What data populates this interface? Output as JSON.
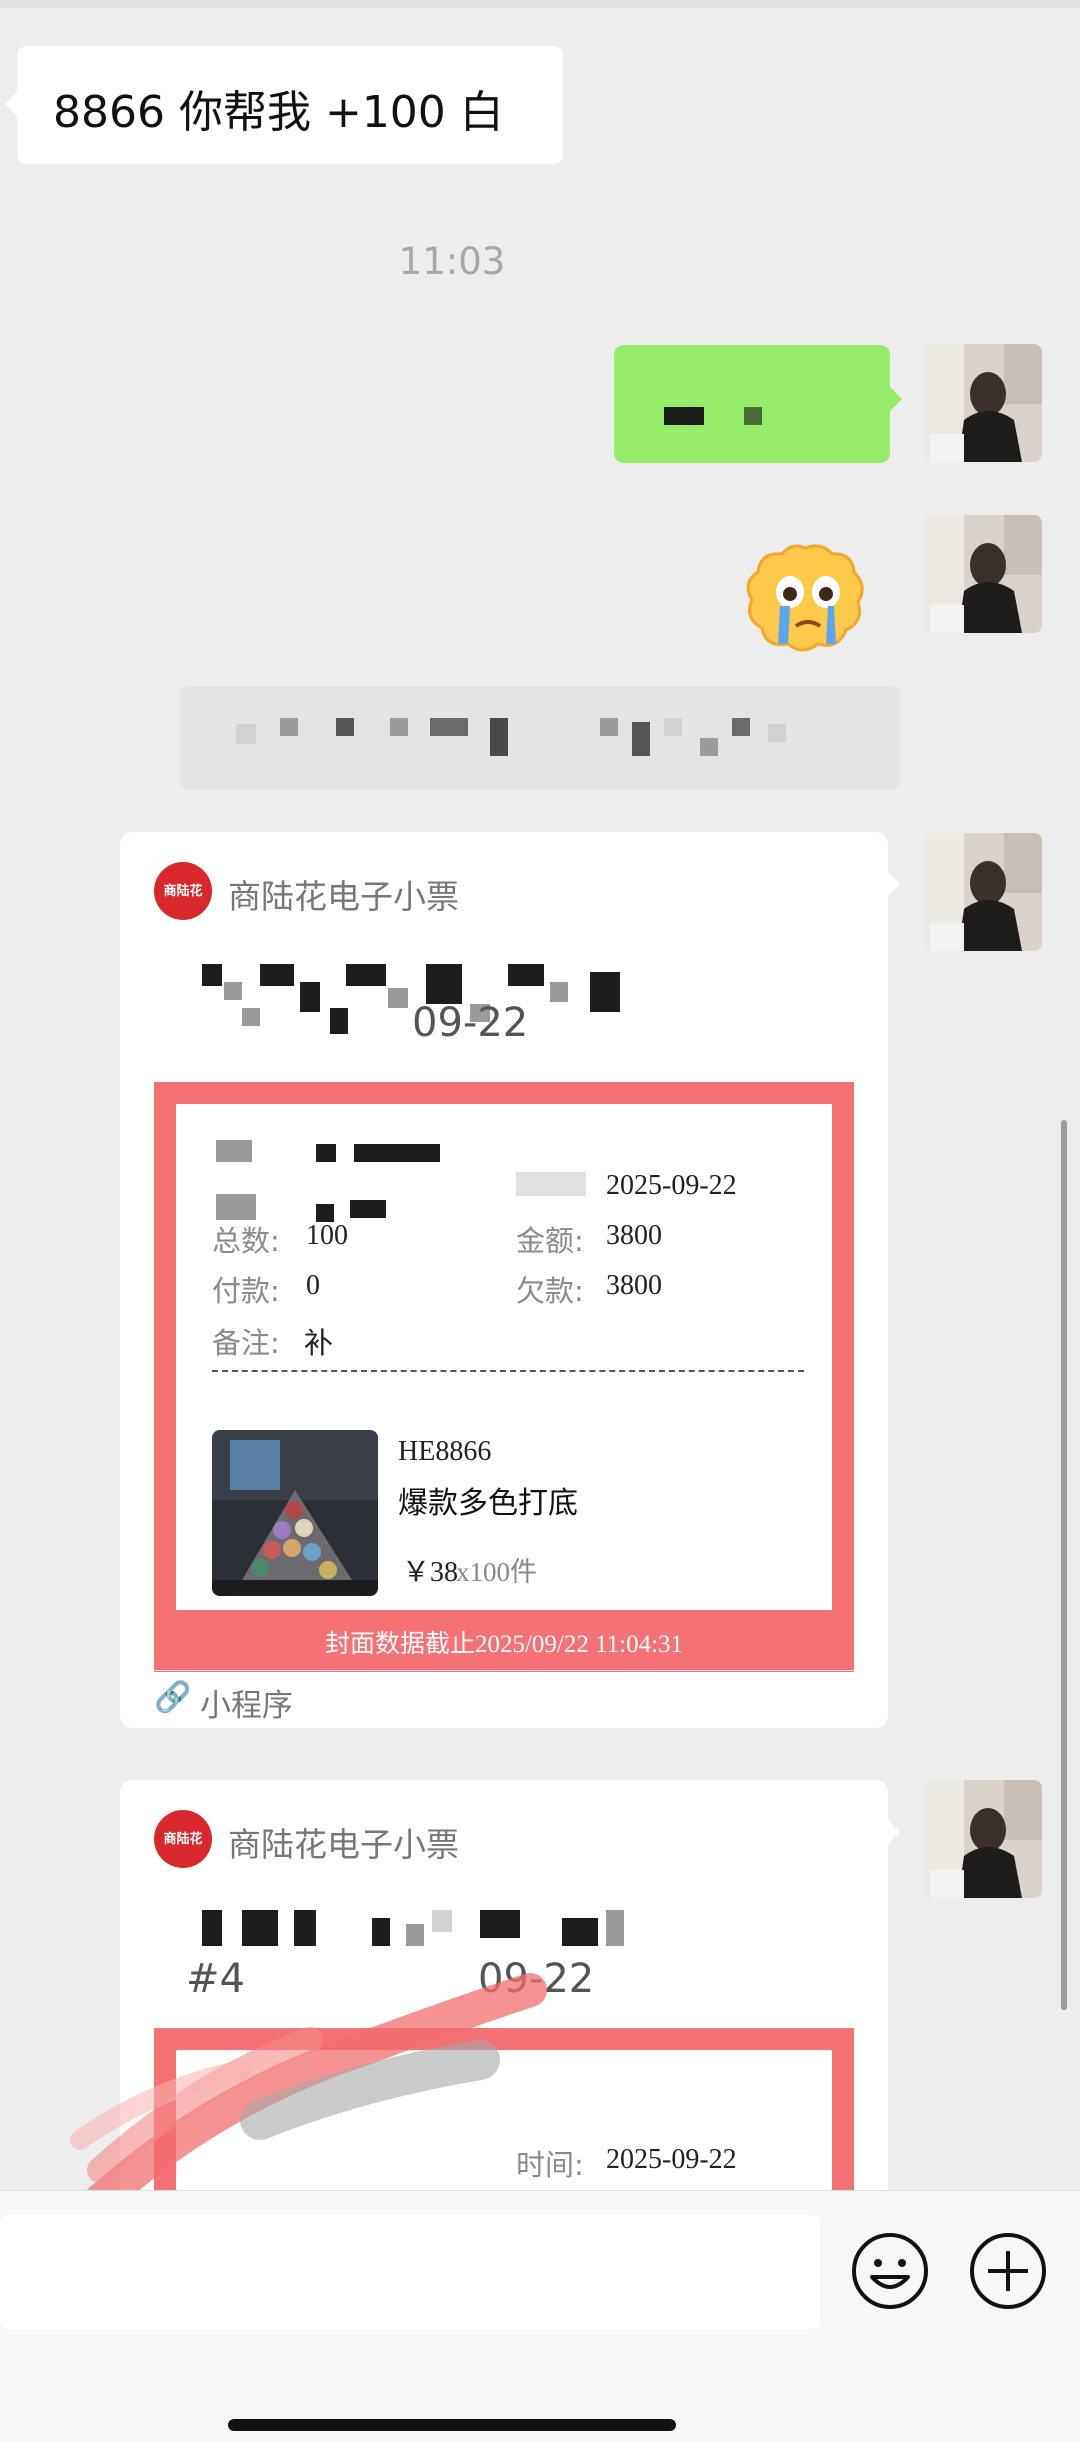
{
  "messages": {
    "incoming_text": "8866 你帮我 +100 白",
    "time_label": "11:03"
  },
  "cards": [
    {
      "app_name": "商陆花电子小票",
      "logo_text": "商陆花",
      "subtitle_suffix": "09-22",
      "receipt": {
        "time_value": "2025-09-22",
        "total_qty_label": "总数:",
        "total_qty_value": "100",
        "amount_label": "金额:",
        "amount_value": "3800",
        "paid_label": "付款:",
        "paid_value": "0",
        "owed_label": "欠款:",
        "owed_value": "3800",
        "note_label": "备注:",
        "note_value": "补",
        "product_code": "HE8866",
        "product_name": "爆款多色打底",
        "product_price": "￥38",
        "product_qty": "x100件",
        "footer": "封面数据截止2025/09/22 11:04:31"
      },
      "mini_program_label": "小程序"
    },
    {
      "app_name": "商陆花电子小票",
      "logo_text": "商陆花",
      "subtitle_text": "#4",
      "subtitle_suffix": "09-22",
      "receipt": {
        "time_label": "时间:",
        "time_value": "2025-09-22"
      }
    }
  ],
  "input_bar": {
    "emoji_icon": "smiley-icon",
    "plus_icon": "plus-circle-icon"
  },
  "colors": {
    "background": "#ededed",
    "sent_bubble": "#95ec69",
    "receipt_frame": "#f47174",
    "logo_red": "#d8282b"
  }
}
